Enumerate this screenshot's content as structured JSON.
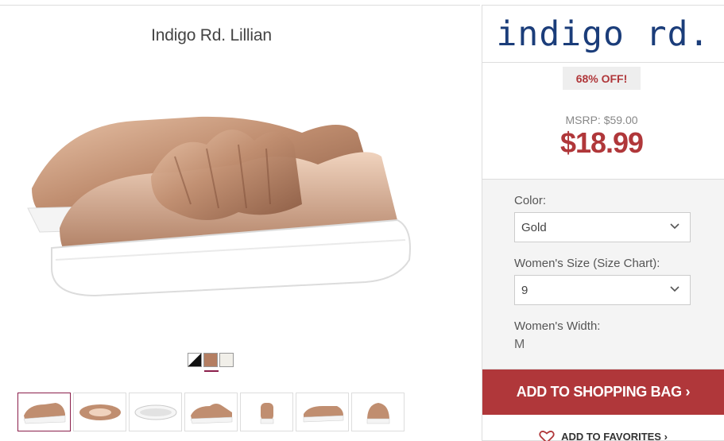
{
  "product": {
    "title": "Indigo Rd. Lillian"
  },
  "brand": {
    "logo_text": "indigo rd.",
    "logo_color": "#1b3d7a"
  },
  "pricing": {
    "discount_badge": "68% OFF!",
    "msrp": "MSRP: $59.00",
    "price": "$18.99",
    "accent_color": "#b0373a"
  },
  "options": {
    "color_label": "Color:",
    "color_value": "Gold",
    "size_label": "Women's Size (Size Chart):",
    "size_value": "9",
    "width_label": "Women's Width:",
    "width_value": "M"
  },
  "swatches": [
    {
      "name": "black-white",
      "color": "#111111"
    },
    {
      "name": "gold",
      "color": "#b47e62"
    },
    {
      "name": "cream",
      "color": "#f1efe9"
    }
  ],
  "actions": {
    "add_to_bag": "ADD TO SHOPPING BAG ›",
    "add_to_favorites": "ADD TO FAVORITES ›"
  }
}
